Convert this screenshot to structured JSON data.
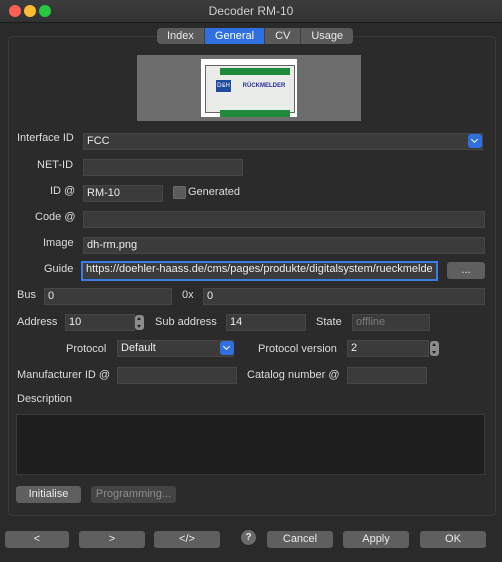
{
  "window": {
    "title": "Decoder RM-10"
  },
  "tabs": [
    {
      "label": "Index"
    },
    {
      "label": "General"
    },
    {
      "label": "CV"
    },
    {
      "label": "Usage"
    }
  ],
  "device_image": {
    "brand": "D&H",
    "text": "RÜCKMELDER"
  },
  "form": {
    "interface_id": {
      "label": "Interface ID",
      "value": "FCC"
    },
    "net_id": {
      "label": "NET-ID",
      "value": ""
    },
    "id": {
      "label": "ID @",
      "value": "RM-10"
    },
    "generated": {
      "label": "Generated",
      "checked": false
    },
    "code": {
      "label": "Code @",
      "value": ""
    },
    "image": {
      "label": "Image",
      "value": "dh-rm.png"
    },
    "guide": {
      "label": "Guide",
      "value": "https://doehler-haass.de/cms/pages/produkte/digitalsystem/rueckmelde",
      "browse": "..."
    },
    "bus": {
      "label": "Bus",
      "value": "0"
    },
    "hex": {
      "label": "0x",
      "value": "0"
    },
    "address": {
      "label": "Address",
      "value": "10"
    },
    "sub_address": {
      "label": "Sub address",
      "value": "14"
    },
    "state": {
      "label": "State",
      "value": "offline"
    },
    "protocol": {
      "label": "Protocol",
      "value": "Default"
    },
    "protocol_version": {
      "label": "Protocol version",
      "value": "2"
    },
    "manufacturer_id": {
      "label": "Manufacturer ID @",
      "value": ""
    },
    "catalog_number": {
      "label": "Catalog number @",
      "value": ""
    },
    "description": {
      "label": "Description",
      "value": ""
    }
  },
  "actions": {
    "initialise": "Initialise",
    "programming": "Programming..."
  },
  "footer": {
    "prev": "<",
    "next": ">",
    "code": "</>",
    "help": "?",
    "cancel": "Cancel",
    "apply": "Apply",
    "ok": "OK"
  }
}
